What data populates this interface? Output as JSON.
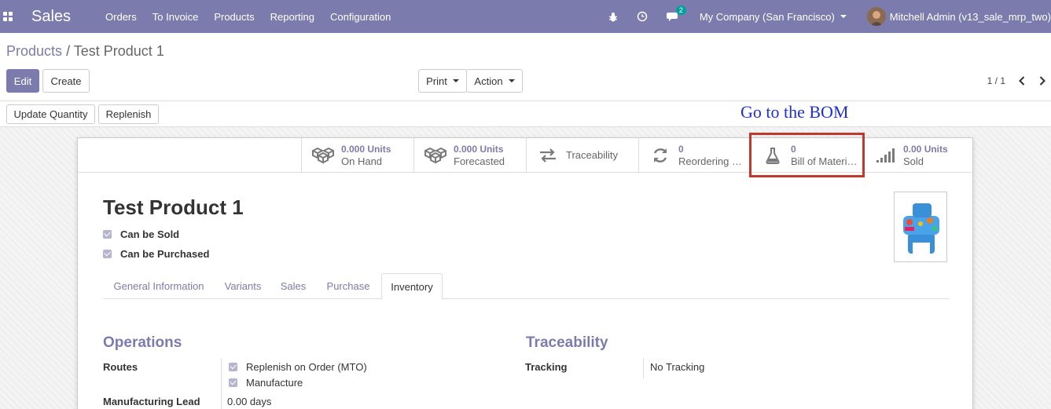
{
  "navbar": {
    "app_name": "Sales",
    "menu": [
      "Orders",
      "To Invoice",
      "Products",
      "Reporting",
      "Configuration"
    ],
    "chat_count": "2",
    "company": "My Company (San Francisco)",
    "user": "Mitchell Admin (v13_sale_mrp_two)"
  },
  "breadcrumb": {
    "parent": "Products",
    "separator": "/",
    "current": "Test Product 1"
  },
  "buttons": {
    "edit": "Edit",
    "create": "Create",
    "print": "Print",
    "action": "Action",
    "update_quantity": "Update Quantity",
    "replenish": "Replenish"
  },
  "pager": "1 / 1",
  "annotation": "Go to the BOM",
  "smart_buttons": [
    {
      "value": "0.000 Units",
      "label": "On Hand",
      "icon": "cubes-icon"
    },
    {
      "value": "0.000 Units",
      "label": "Forecasted",
      "icon": "cubes-icon"
    },
    {
      "value": "",
      "label": "Traceability",
      "icon": "exchange-icon"
    },
    {
      "value": "0",
      "label": "Reordering …",
      "icon": "refresh-icon"
    },
    {
      "value": "0",
      "label": "Bill of Materi…",
      "icon": "flask-icon"
    },
    {
      "value": "0.00 Units",
      "label": "Sold",
      "icon": "signal-icon"
    }
  ],
  "product": {
    "name": "Test Product 1",
    "can_be_sold": "Can be Sold",
    "can_be_purchased": "Can be Purchased"
  },
  "tabs": [
    "General Information",
    "Variants",
    "Sales",
    "Purchase",
    "Inventory"
  ],
  "active_tab": "Inventory",
  "operations": {
    "title": "Operations",
    "routes_label": "Routes",
    "routes": [
      "Replenish on Order (MTO)",
      "Manufacture"
    ],
    "lead_label": "Manufacturing Lead",
    "lead_value": "0.00 days"
  },
  "traceability": {
    "title": "Traceability",
    "tracking_label": "Tracking",
    "tracking_value": "No Tracking"
  },
  "colors": {
    "brand": "#7c7bad",
    "highlight": "#c0392b",
    "annotation": "#1f2fd6"
  }
}
